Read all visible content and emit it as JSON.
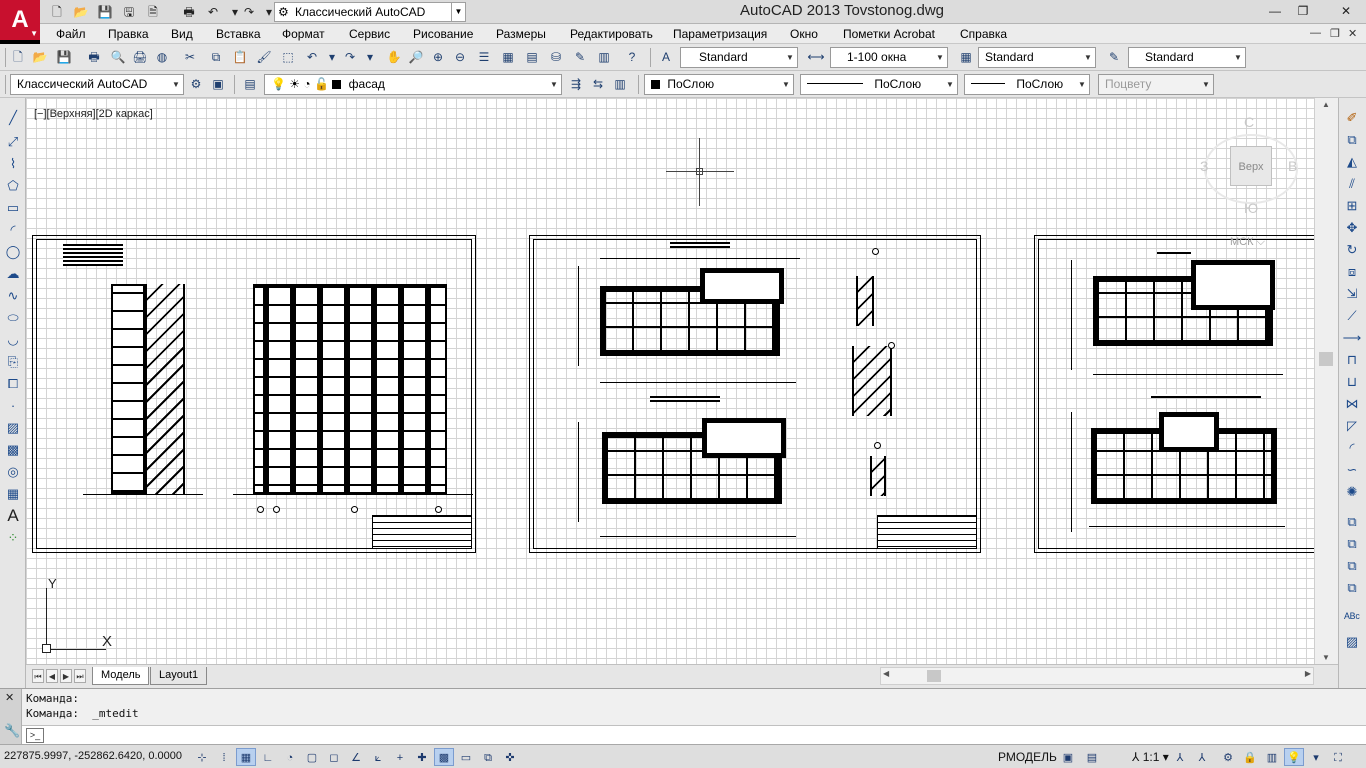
{
  "app": {
    "logo_letter": "A",
    "window_title": "AutoCAD 2013    Tovstonog.dwg",
    "workspace": "Классический AutoCAD"
  },
  "menu": {
    "items": [
      "Файл",
      "Правка",
      "Вид",
      "Вставка",
      "Формат",
      "Сервис",
      "Рисование",
      "Размеры",
      "Редактировать",
      "Параметризация",
      "Окно",
      "Пометки Acrobat",
      "Справка"
    ]
  },
  "styles_toolbar": {
    "text_style": "Standard",
    "dim_style": "1-100 окна",
    "table_style": "Standard",
    "multileader_style": "Standard"
  },
  "layers_toolbar": {
    "workspace": "Классический AutoCAD",
    "current_layer": "фасад",
    "color": "ПоСлою",
    "linetype": "ПоСлою",
    "lineweight": "ПоСлою",
    "plotstyle": "Поцвету"
  },
  "viewport": {
    "label": "[−][Верхняя][2D каркас]"
  },
  "viewcube": {
    "north": "С",
    "south": "Ю",
    "west": "З",
    "east": "В",
    "face": "Верх",
    "wcs": "МСК"
  },
  "ucs": {
    "x": "X",
    "y": "Y"
  },
  "tabs": {
    "model": "Модель",
    "layout1": "Layout1"
  },
  "command": {
    "history": [
      "Команда:",
      "Команда:  _mtedit"
    ],
    "input": ""
  },
  "status": {
    "coordinates": "227875.9997, -252862.6420, 0.0000",
    "space": "РМОДЕЛЬ",
    "annotation_scale": "1:1"
  },
  "icons": {
    "colors": {
      "logo_bg": "#c8102e",
      "grid": "#d4d4d4",
      "toolbar": "#e6e6e6"
    }
  }
}
